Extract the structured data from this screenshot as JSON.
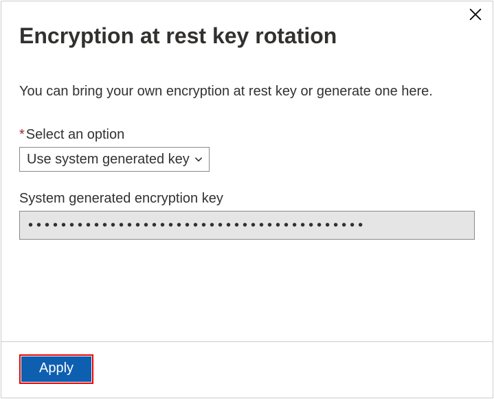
{
  "title": "Encryption at rest key rotation",
  "description": "You can bring your own encryption at rest key or generate one here.",
  "option_label": "Select an option",
  "option_selected": "Use system generated key",
  "key_label": "System generated encryption key",
  "key_value_masked": "•••••••••••••••••••••••••••••••••••••••••",
  "apply_label": "Apply"
}
